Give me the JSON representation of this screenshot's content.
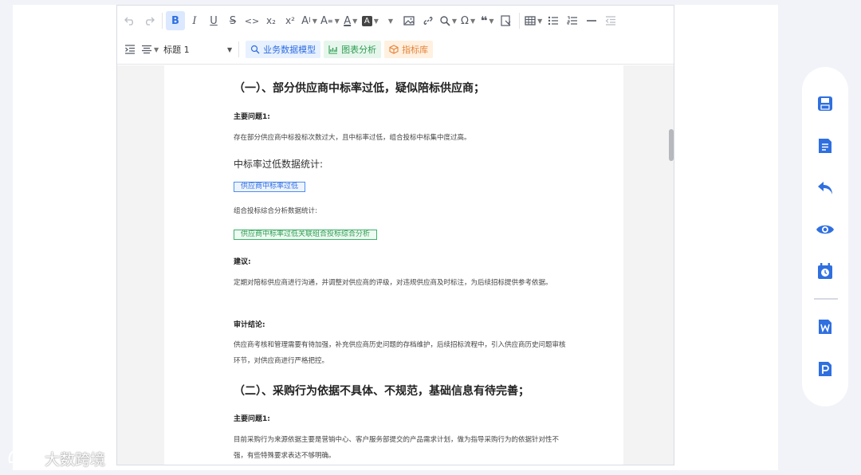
{
  "colors": {
    "accent": "#2f6fe0",
    "sidebar_icon": "#2f6fe0",
    "green": "#2e9d52",
    "orange": "#e4843a"
  },
  "toolbar": {
    "heading_select": "标题 1",
    "chips": [
      {
        "label": "业务数据模型",
        "icon": "model-icon"
      },
      {
        "label": "图表分析",
        "icon": "chart-icon"
      },
      {
        "label": "指标库",
        "icon": "cube-icon"
      }
    ],
    "font_size_label": "A",
    "superscript": "x²",
    "subscript": "x₂"
  },
  "document": {
    "section1_title": "（一）、部分供应商中标率过低，疑似陪标供应商；",
    "issue1_label": "主要问题1:",
    "issue1_text": "存在部分供应商中标投标次数过大，且中标率过低，组合投标中标集中度过高。",
    "stats_title": "中标率过低数据统计:",
    "tag1": "供应商中标率过低",
    "combo_title": "组合投标综合分析数据统计:",
    "tag2": "供应商中标率过低关联组合投标综合分析",
    "suggest_label": "建议:",
    "suggest_text": "定期对陪标供应商进行沟通，并调整对供应商的评级，对违规供应商及时标注，为后续招标提供参考依据。",
    "conclusion_label": "审计结论:",
    "conclusion_text": "供应商考核和管理需要有待加强，补充供应商历史问题的存档维护，后续招标流程中，引入供应商历史问题审核环节，对供应商进行严格把控。",
    "section2_title": "（二）、采购行为依据不具体、不规范，基础信息有待完善；",
    "issue2_label": "主要问题1:",
    "issue2_text": "目前采购行为来源依据主要是营销中心、客户服务部提交的产品需求计划，做为指导采购行为的依据针对性不强，有些特殊要求表达不够明确。"
  },
  "sidebar": {
    "items": [
      "save-icon",
      "save-as-icon",
      "undo-icon",
      "preview-icon",
      "history-icon",
      "word-export-icon",
      "pdf-export-icon"
    ]
  },
  "watermark": {
    "text": "大数跨境"
  }
}
